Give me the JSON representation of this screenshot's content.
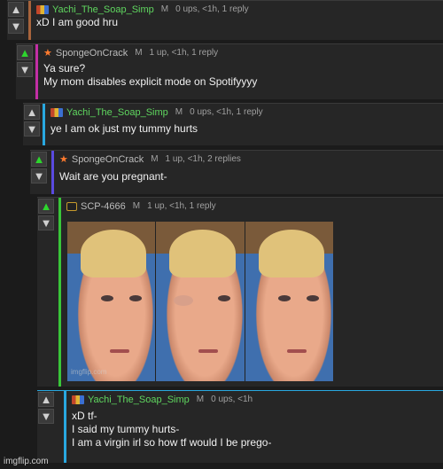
{
  "colors": {
    "page_bg": "#1b1b1b",
    "card_bg": "#262626",
    "username_green": "#5fd65f",
    "upvote_active": "#2dd62d",
    "star_orange": "#ff7b2e",
    "bar_brown": "#a8643c",
    "bar_magenta": "#c22fa5",
    "bar_cyan": "#29a8e0",
    "bar_indigo": "#5a4ae0",
    "bar_green": "#39c639",
    "bar_cyan2": "#29a8e0"
  },
  "icons": {
    "upvote": "▲",
    "downvote": "▼",
    "star": "★"
  },
  "comments": [
    {
      "user": "Yachi_The_Soap_Simp",
      "badge": "M",
      "stats": "0 ups, <1h, 1 reply",
      "text": "xD I am good hru"
    },
    {
      "user": "SpongeOnCrack",
      "badge": "M",
      "stats": "1 up, <1h, 1 reply",
      "text": "Ya sure?\nMy mom disables explicit mode on Spotifyyyy"
    },
    {
      "user": "Yachi_The_Soap_Simp",
      "badge": "M",
      "stats": "0 ups, <1h, 1 reply",
      "text": "ye I am ok just my tummy hurts"
    },
    {
      "user": "SpongeOnCrack",
      "badge": "M",
      "stats": "1 up, <1h, 2 replies",
      "text": "Wait are you pregnant-"
    },
    {
      "user": "SCP-4666",
      "badge": "M",
      "stats": "1 up, <1h, 1 reply",
      "text": "",
      "image_watermark": "imgflip.com"
    },
    {
      "user": "Yachi_The_Soap_Simp",
      "badge": "M",
      "stats": "0 ups, <1h",
      "text": "xD tf-\nI said my tummy hurts-\nI am a virgin irl so how tf would I be prego-"
    }
  ],
  "site_watermark": "imgflip.com"
}
